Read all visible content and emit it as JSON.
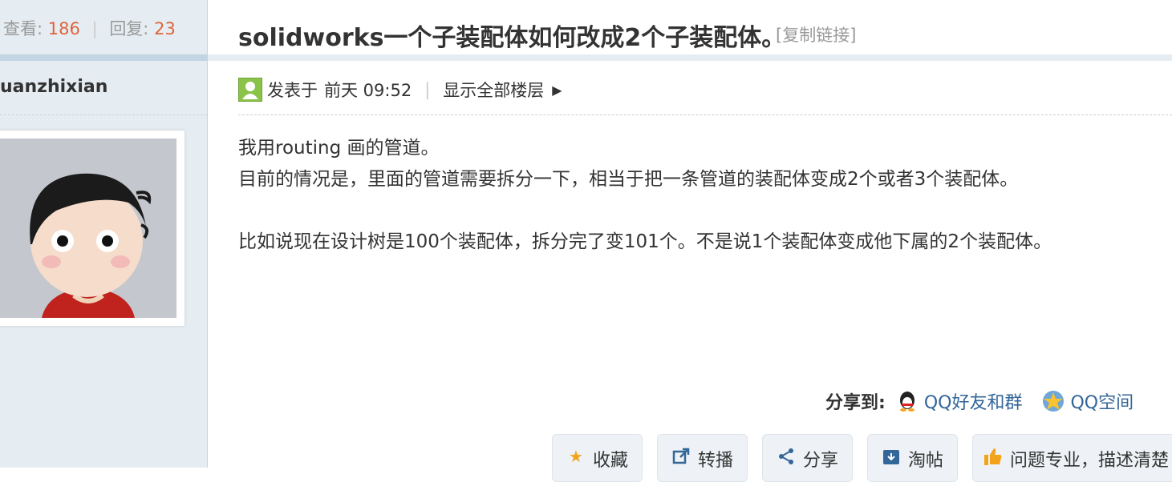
{
  "thread": {
    "views_label": "查看:",
    "views": "186",
    "replies_label": "回复:",
    "replies": "23",
    "title": "solidworks一个子装配体如何改成2个子装配体。",
    "copy_link": "[复制链接]"
  },
  "author": {
    "username": "uanzhixian"
  },
  "post": {
    "posted_label": "发表于",
    "posted_time": "前天 09:52",
    "show_all_floors": "显示全部楼层",
    "lines": [
      "我用routing 画的管道。",
      "目前的情况是，里面的管道需要拆分一下，相当于把一条管道的装配体变成2个或者3个装配体。",
      "比如说现在设计树是100个装配体，拆分完了变101个。不是说1个装配体变成他下属的2个装配体。"
    ]
  },
  "share": {
    "label": "分享到:",
    "qq_friends": "QQ好友和群",
    "qq_zone": "QQ空间"
  },
  "actions": {
    "favorite": "收藏",
    "repost": "转播",
    "share": "分享",
    "taotie": "淘帖",
    "rate": "问题专业，描述清楚"
  },
  "colors": {
    "accent": "#336699",
    "count": "#e0633a",
    "sidebar_bg": "#e5edf2"
  }
}
